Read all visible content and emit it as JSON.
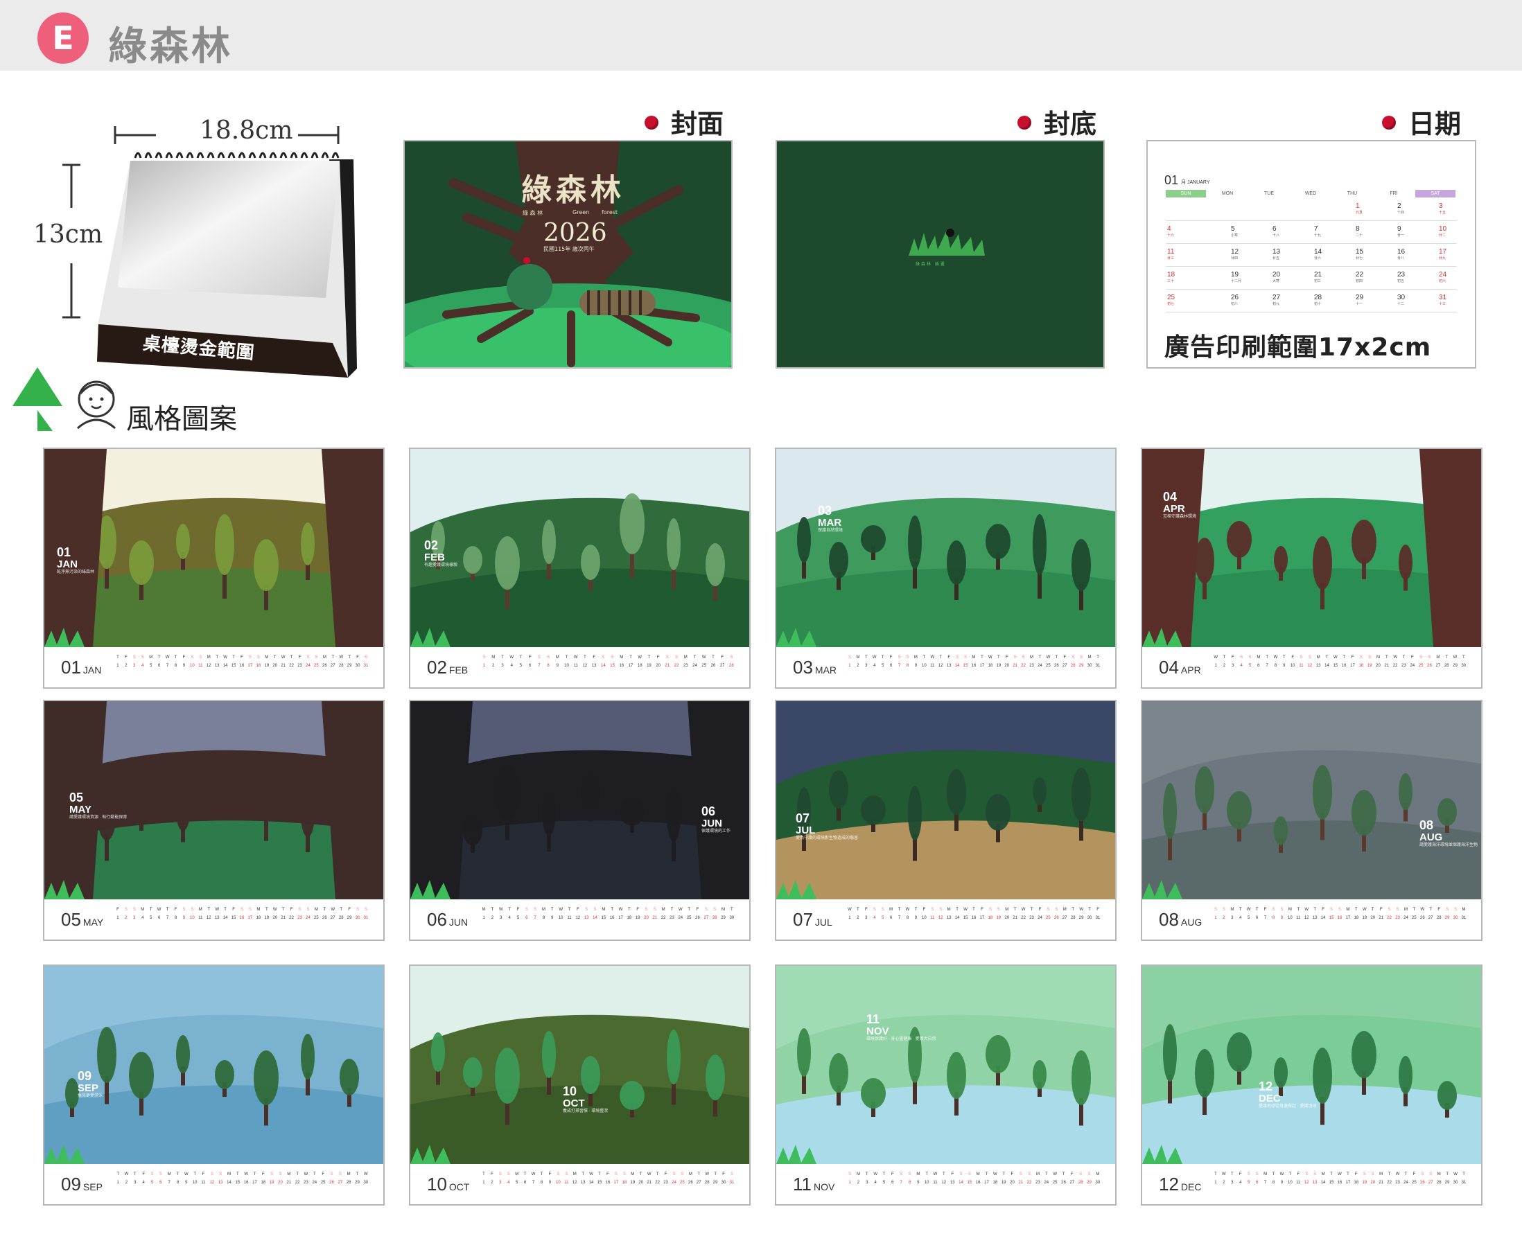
{
  "header": {
    "badge": "E",
    "title": "綠森林"
  },
  "labels": {
    "front_cover": "封面",
    "back_cover": "封底",
    "date_page": "日期"
  },
  "desk_calendar": {
    "width_label": "18.8cm",
    "height_label": "13cm",
    "foil_area": "桌檯燙金範圍"
  },
  "style_section": {
    "label": "風格圖案"
  },
  "front_cover": {
    "logo": "綠森林",
    "subtitle_cn": "綠 森 林",
    "subtitle_en_1": "Green",
    "subtitle_en_2": "forest",
    "year": "2026",
    "year_note": "民國115年 歲次丙午"
  },
  "back_cover": {
    "caption": "綠森林 插畫"
  },
  "date_page": {
    "month_num": "01",
    "month_name": "月 JANUARY",
    "weekdays": [
      "SUN",
      "MON",
      "TUE",
      "WED",
      "THU",
      "FRI",
      "SAT"
    ],
    "rows": [
      [
        [
          "",
          ""
        ],
        [
          "",
          ""
        ],
        [
          "",
          ""
        ],
        [
          "",
          ""
        ],
        [
          "1",
          "元旦"
        ],
        [
          "2",
          "十四"
        ],
        [
          "3",
          "十五"
        ]
      ],
      [
        [
          "4",
          "十六"
        ],
        [
          "5",
          "小寒"
        ],
        [
          "6",
          "十八"
        ],
        [
          "7",
          "十九"
        ],
        [
          "8",
          "二十"
        ],
        [
          "9",
          "廿一"
        ],
        [
          "10",
          "廿二"
        ]
      ],
      [
        [
          "11",
          "廿三"
        ],
        [
          "12",
          "廿四"
        ],
        [
          "13",
          "廿五"
        ],
        [
          "14",
          "廿六"
        ],
        [
          "15",
          "廿七"
        ],
        [
          "16",
          "廿八"
        ],
        [
          "17",
          "廿九"
        ]
      ],
      [
        [
          "18",
          "三十"
        ],
        [
          "19",
          "十二月"
        ],
        [
          "20",
          "大寒"
        ],
        [
          "21",
          "初三"
        ],
        [
          "22",
          "初四"
        ],
        [
          "23",
          "初五"
        ],
        [
          "24",
          "初六"
        ]
      ],
      [
        [
          "25",
          "初七"
        ],
        [
          "26",
          "初八"
        ],
        [
          "27",
          "初九"
        ],
        [
          "28",
          "初十"
        ],
        [
          "29",
          "十一"
        ],
        [
          "30",
          "十二"
        ],
        [
          "31",
          "十三"
        ]
      ]
    ],
    "ad_text": "廣告印刷範圍17x2cm"
  },
  "months": [
    {
      "num": "01",
      "abbr": "JAN",
      "label_num": "01",
      "label_mon": "JAN",
      "caption": "乾淨無污染的綠森林",
      "start": 4,
      "days": 31,
      "scheme": "jan"
    },
    {
      "num": "02",
      "abbr": "FEB",
      "label_num": "02",
      "label_mon": "FEB",
      "caption": "有趣愛護環境樣貌",
      "start": 0,
      "days": 28,
      "scheme": "feb"
    },
    {
      "num": "03",
      "abbr": "MAR",
      "label_num": "03",
      "label_mon": "MAR",
      "caption": "保護自然環境",
      "start": 0,
      "days": 31,
      "scheme": "mar"
    },
    {
      "num": "04",
      "abbr": "APR",
      "label_num": "04",
      "label_mon": "APR",
      "caption": "互相守護森林環境",
      "start": 3,
      "days": 30,
      "scheme": "apr"
    },
    {
      "num": "05",
      "abbr": "MAY",
      "label_num": "05",
      "label_mon": "MAY",
      "caption": "請愛護環境資源 · 執行動能保育",
      "start": 5,
      "days": 31,
      "scheme": "may"
    },
    {
      "num": "06",
      "abbr": "JUN",
      "label_num": "06",
      "label_mon": "JUN",
      "caption": "保護環境的工作",
      "start": 1,
      "days": 30,
      "scheme": "jun"
    },
    {
      "num": "07",
      "abbr": "JUL",
      "label_num": "07",
      "label_mon": "JUL",
      "caption": "愛鳥守護的環境對生物造成的傷害",
      "start": 3,
      "days": 31,
      "scheme": "jul"
    },
    {
      "num": "08",
      "abbr": "AUG",
      "label_num": "08",
      "label_mon": "AUG",
      "caption": "請愛護海洋環境並保護海洋生物",
      "start": 6,
      "days": 31,
      "scheme": "aug"
    },
    {
      "num": "09",
      "abbr": "SEP",
      "label_num": "09",
      "label_mon": "SEP",
      "caption": "魚兒更愛游泳",
      "start": 2,
      "days": 30,
      "scheme": "sep"
    },
    {
      "num": "10",
      "abbr": "OCT",
      "label_num": "10",
      "label_mon": "OCT",
      "caption": "養成打掃習慣 · 環境整潔",
      "start": 4,
      "days": 31,
      "scheme": "oct"
    },
    {
      "num": "11",
      "abbr": "NOV",
      "label_num": "11",
      "label_mon": "NOV",
      "caption": "環境保護好 · 身心靈健康 · 愛護大自然",
      "start": 0,
      "days": 30,
      "scheme": "nov"
    },
    {
      "num": "12",
      "abbr": "DEC",
      "label_num": "12",
      "label_mon": "DEC",
      "caption": "愛護地球從身邊做起 · 愛護地球",
      "start": 2,
      "days": 31,
      "scheme": "dec"
    }
  ],
  "colors": {
    "accent_pink": "#ee5f7c",
    "dot_red": "#c8102e",
    "forest_green": "#154a2b",
    "weekend_red": "#d9302f",
    "sun_green": "#8ccf8a",
    "sat_purple": "#c7a6e0"
  }
}
